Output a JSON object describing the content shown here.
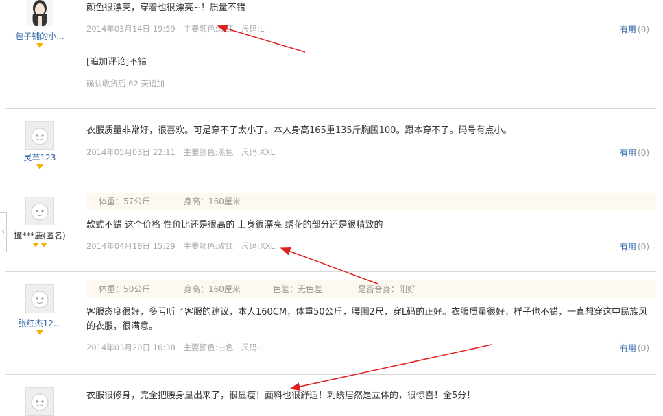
{
  "reviews": [
    {
      "user": "包子铺的小...",
      "text": "颜色很漂亮，穿着也很漂亮~！质量不错",
      "date": "2014年03月14日 19:59",
      "color": "主要颜色:玫红",
      "size": "尺码:L",
      "useful_label": "有用",
      "useful_count": "(0)",
      "appended_text": "[追加评论]不错",
      "appended_meta": "确认收货后 62 天追加"
    },
    {
      "user": "灵草123",
      "text": "衣服质量非常好，很喜欢。可是穿不了太小了。本人身高165重135斤胸围100。跟本穿不了。码号有点小。",
      "date": "2014年05月03日 22:11",
      "color": "主要颜色:黑色",
      "size": "尺码:XXL",
      "useful_label": "有用",
      "useful_count": "(0)"
    },
    {
      "user": "撞***鹿(匿名)",
      "info_weight": "体重：57公斤",
      "info_height": "身高：160厘米",
      "text": "款式不错 这个价格 性价比还是很高的 上身很漂亮 绣花的部分还是很精致的",
      "date": "2014年04月18日 15:29",
      "color": "主要颜色:玫红",
      "size": "尺码:XXL",
      "useful_label": "有用",
      "useful_count": "(0)"
    },
    {
      "user": "张红杰12...",
      "info_weight": "体重：50公斤",
      "info_height": "身高：160厘米",
      "info_color_diff": "色差：无色差",
      "info_fit": "是否合身：刚好",
      "text": "客服态度很好，多亏听了客服的建议，本人160CM，体重50公斤，腰围2尺，穿L码的正好。衣服质量很好，样子也不错，一直想穿这中民族风的衣服，很满意。",
      "date": "2014年03月20日 16:38",
      "color": "主要颜色:白色",
      "size": "尺码:L",
      "useful_label": "有用",
      "useful_count": "(0)"
    },
    {
      "text": "衣服很修身，完全把腰身显出来了，很显瘦！面料也很舒适！刺绣居然是立体的，很惊喜！全5分！"
    }
  ],
  "side_handle": "‹",
  "colors": {
    "link": "#3366aa",
    "meta": "#aaaaaa",
    "arrow": "#e02020",
    "gem": "#f0b400",
    "info_bg": "#fdf8f0"
  }
}
